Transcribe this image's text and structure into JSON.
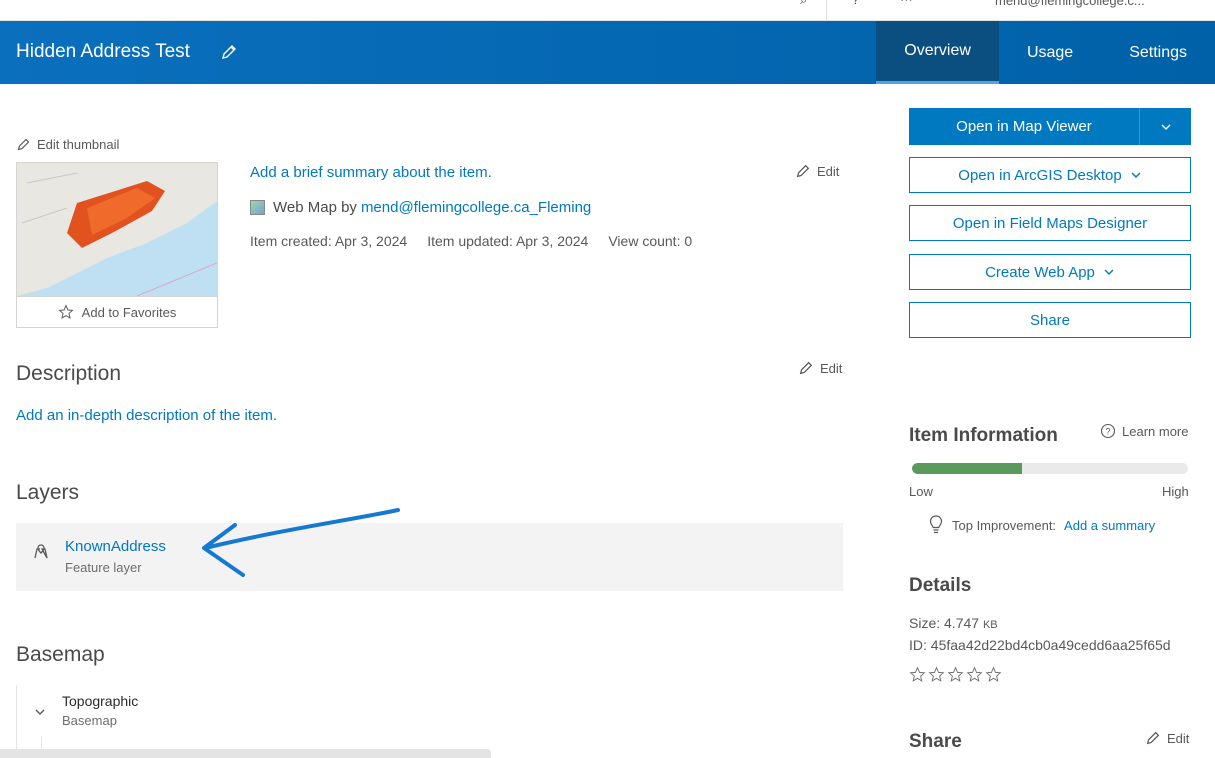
{
  "top": {
    "user": "mend@flemingcollege.c..."
  },
  "header": {
    "title": "Hidden Address Test",
    "tabs": [
      {
        "label": "Overview"
      },
      {
        "label": "Usage"
      },
      {
        "label": "Settings"
      }
    ]
  },
  "thumbnail": {
    "edit_label": "Edit thumbnail",
    "favorites_label": "Add to Favorites"
  },
  "summary": {
    "text": "Add a brief summary about the item.",
    "edit_label": "Edit",
    "type": "Web Map by",
    "owner": "mend@flemingcollege.ca_Fleming",
    "created": "Item created: Apr 3, 2024",
    "updated": "Item updated: Apr 3, 2024",
    "views": "View count: 0"
  },
  "description": {
    "title": "Description",
    "edit_label": "Edit",
    "text": "Add an in-depth description of the item."
  },
  "layers": {
    "title": "Layers",
    "items": [
      {
        "name": "KnownAddress",
        "type": "Feature layer"
      }
    ]
  },
  "basemap": {
    "title": "Basemap",
    "name": "Topographic",
    "type": "Basemap"
  },
  "actions": {
    "open_map_viewer": "Open in Map Viewer",
    "open_arcgis_desktop": "Open in ArcGIS Desktop",
    "open_field_maps": "Open in Field Maps Designer",
    "create_web_app": "Create Web App",
    "share": "Share"
  },
  "item_info": {
    "title": "Item Information",
    "learn_more": "Learn more",
    "score_fraction": 0.4,
    "low": "Low",
    "high": "High",
    "improvement_label": "Top Improvement:",
    "improvement_link": "Add a summary"
  },
  "details": {
    "title": "Details",
    "size_label": "Size: 4.747",
    "size_unit": "KB",
    "id": "ID: 45faa42d22bd4cb0a49cedd6aa25f65d",
    "rating": 0
  },
  "share": {
    "title": "Share",
    "edit_label": "Edit"
  },
  "colors": {
    "brand_blue": "#0079c1",
    "header_blue": "#0a6fbd",
    "meter_green": "#5a9b5d"
  }
}
